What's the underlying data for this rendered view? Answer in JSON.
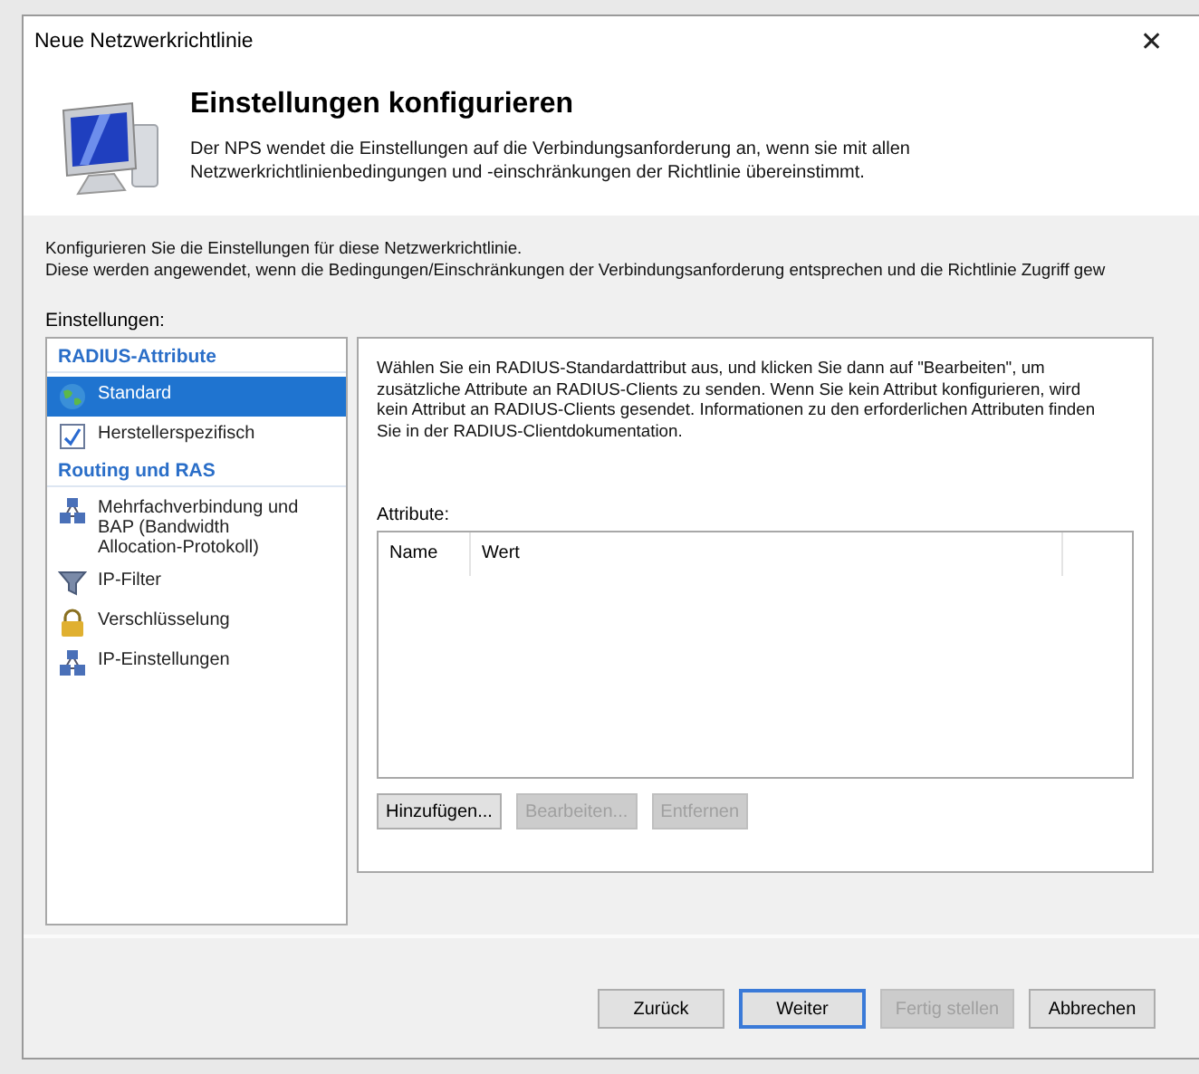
{
  "window": {
    "title": "Neue Netzwerkrichtlinie",
    "close": "✕"
  },
  "header": {
    "title": "Einstellungen konfigurieren",
    "description": "Der NPS wendet die Einstellungen auf die Verbindungsanforderung an, wenn sie mit allen Netzwerkrichtlinienbedingungen und -einschränkungen der Richtlinie übereinstimmt."
  },
  "intro": [
    "Konfigurieren Sie die Einstellungen für diese Netzwerkrichtlinie.",
    "Diese werden angewendet, wenn die Bedingungen/Einschränkungen der Verbindungsanforderung entsprechen und die Richtlinie Zugriff gew"
  ],
  "settings_label": "Einstellungen:",
  "sidebar": {
    "items": [
      {
        "kind": "header",
        "label": "RADIUS-Attribute"
      },
      {
        "kind": "item",
        "label": "Standard",
        "selected": true
      },
      {
        "kind": "item",
        "label": "Herstellerspezifisch",
        "selected": false
      },
      {
        "kind": "header",
        "label": "Routing und RAS"
      },
      {
        "kind": "item",
        "label": "Mehrfachverbindung und BAP (Bandwidth Allocation-Protokoll)",
        "selected": false
      },
      {
        "kind": "item",
        "label": "IP-Filter",
        "selected": false
      },
      {
        "kind": "item",
        "label": "Verschlüsselung",
        "selected": false
      },
      {
        "kind": "item",
        "label": "IP-Einstellungen",
        "selected": false
      }
    ]
  },
  "panel": {
    "description": "Wählen Sie ein RADIUS-Standardattribut aus, und klicken Sie dann auf \"Bearbeiten\", um zusätzliche Attribute an RADIUS-Clients zu senden. Wenn Sie kein Attribut konfigurieren, wird kein Attribut an RADIUS-Clients gesendet. Informationen zu den erforderlichen Attributen finden Sie in der RADIUS-Clientdokumentation.",
    "list_label": "Attribute:",
    "table": {
      "columns": [
        "Name",
        "Wert"
      ]
    },
    "buttons": [
      {
        "label": "Hinzufügen...",
        "disabled": false
      },
      {
        "label": "Bearbeiten...",
        "disabled": true
      },
      {
        "label": "Entfernen",
        "disabled": true
      }
    ]
  },
  "footer_buttons": [
    {
      "label": "Zurück",
      "disabled": false,
      "default": false
    },
    {
      "label": "Weiter",
      "disabled": false,
      "default": true
    },
    {
      "label": "Fertig stellen",
      "disabled": true,
      "default": false
    },
    {
      "label": "Abbrechen",
      "disabled": false,
      "default": false
    }
  ]
}
